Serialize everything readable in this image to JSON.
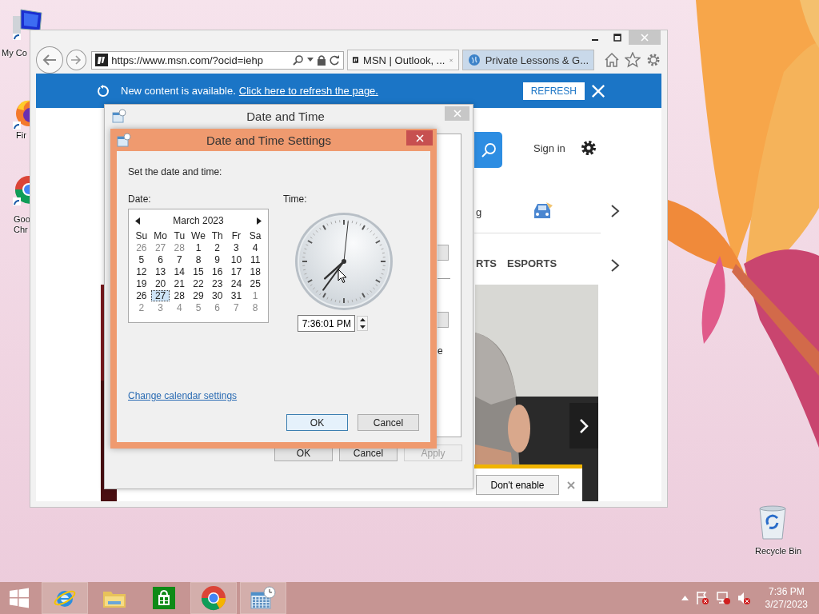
{
  "desktop": {
    "icons": [
      {
        "kind": "computer",
        "label_lines": [
          "My Co"
        ]
      },
      {
        "kind": "firefox",
        "label_lines": [
          "Fir"
        ]
      },
      {
        "kind": "chrome",
        "label_lines": [
          "Goo",
          "Chr"
        ]
      },
      {
        "kind": "recycle",
        "label_lines": [
          "Recycle Bin"
        ]
      }
    ]
  },
  "browser": {
    "address": "https://www.msn.com/?ocid=iehp",
    "tabs": [
      {
        "label": "MSN | Outlook, ...",
        "selected": true
      },
      {
        "label": "Private Lessons & G...",
        "selected": false
      }
    ],
    "notification": {
      "text": "New content is available.",
      "link": "Click here to refresh the page.",
      "button": "REFRESH"
    },
    "page": {
      "sign_in": "Sign in",
      "cut_text": "g",
      "nav_items": [
        "RTS",
        "ESPORTS"
      ],
      "popup_button": "Don't enable"
    }
  },
  "date_time_window": {
    "title": "Date and Time",
    "cut_text": "e",
    "buttons": [
      {
        "label": "OK",
        "disabled": false
      },
      {
        "label": "Cancel",
        "disabled": false
      },
      {
        "label": "Apply",
        "disabled": true
      }
    ]
  },
  "settings_dialog": {
    "title": "Date and Time Settings",
    "prompt": "Set the date and time:",
    "date_label": "Date:",
    "time_label": "Time:",
    "calendar": {
      "month": "March 2023",
      "weekdays": [
        "Su",
        "Mo",
        "Tu",
        "We",
        "Th",
        "Fr",
        "Sa"
      ],
      "weeks": [
        [
          {
            "day": "26",
            "current_month": false,
            "selected": false
          },
          {
            "day": "27",
            "current_month": false,
            "selected": false
          },
          {
            "day": "28",
            "current_month": false,
            "selected": false
          },
          {
            "day": "1",
            "current_month": true,
            "selected": false
          },
          {
            "day": "2",
            "current_month": true,
            "selected": false
          },
          {
            "day": "3",
            "current_month": true,
            "selected": false
          },
          {
            "day": "4",
            "current_month": true,
            "selected": false
          }
        ],
        [
          {
            "day": "5",
            "current_month": true,
            "selected": false
          },
          {
            "day": "6",
            "current_month": true,
            "selected": false
          },
          {
            "day": "7",
            "current_month": true,
            "selected": false
          },
          {
            "day": "8",
            "current_month": true,
            "selected": false
          },
          {
            "day": "9",
            "current_month": true,
            "selected": false
          },
          {
            "day": "10",
            "current_month": true,
            "selected": false
          },
          {
            "day": "11",
            "current_month": true,
            "selected": false
          }
        ],
        [
          {
            "day": "12",
            "current_month": true,
            "selected": false
          },
          {
            "day": "13",
            "current_month": true,
            "selected": false
          },
          {
            "day": "14",
            "current_month": true,
            "selected": false
          },
          {
            "day": "15",
            "current_month": true,
            "selected": false
          },
          {
            "day": "16",
            "current_month": true,
            "selected": false
          },
          {
            "day": "17",
            "current_month": true,
            "selected": false
          },
          {
            "day": "18",
            "current_month": true,
            "selected": false
          }
        ],
        [
          {
            "day": "19",
            "current_month": true,
            "selected": false
          },
          {
            "day": "20",
            "current_month": true,
            "selected": false
          },
          {
            "day": "21",
            "current_month": true,
            "selected": false
          },
          {
            "day": "22",
            "current_month": true,
            "selected": false
          },
          {
            "day": "23",
            "current_month": true,
            "selected": false
          },
          {
            "day": "24",
            "current_month": true,
            "selected": false
          },
          {
            "day": "25",
            "current_month": true,
            "selected": false
          }
        ],
        [
          {
            "day": "26",
            "current_month": true,
            "selected": false
          },
          {
            "day": "27",
            "current_month": true,
            "selected": true
          },
          {
            "day": "28",
            "current_month": true,
            "selected": false
          },
          {
            "day": "29",
            "current_month": true,
            "selected": false
          },
          {
            "day": "30",
            "current_month": true,
            "selected": false
          },
          {
            "day": "31",
            "current_month": true,
            "selected": false
          },
          {
            "day": "1",
            "current_month": false,
            "selected": false
          }
        ],
        [
          {
            "day": "2",
            "current_month": false,
            "selected": false
          },
          {
            "day": "3",
            "current_month": false,
            "selected": false
          },
          {
            "day": "4",
            "current_month": false,
            "selected": false
          },
          {
            "day": "5",
            "current_month": false,
            "selected": false
          },
          {
            "day": "6",
            "current_month": false,
            "selected": false
          },
          {
            "day": "7",
            "current_month": false,
            "selected": false
          },
          {
            "day": "8",
            "current_month": false,
            "selected": false
          }
        ]
      ]
    },
    "time_value": "7:36:01 PM",
    "link": "Change calendar settings",
    "buttons": [
      {
        "label": "OK",
        "default": true
      },
      {
        "label": "Cancel",
        "default": false
      }
    ]
  },
  "taskbar": {
    "apps": [
      {
        "kind": "ie",
        "running": true
      },
      {
        "kind": "explorer",
        "running": false
      },
      {
        "kind": "store",
        "running": false
      },
      {
        "kind": "chrome",
        "running": true
      },
      {
        "kind": "datetime",
        "running": true
      }
    ],
    "clock": {
      "time": "7:36 PM",
      "date": "3/27/2023"
    }
  }
}
